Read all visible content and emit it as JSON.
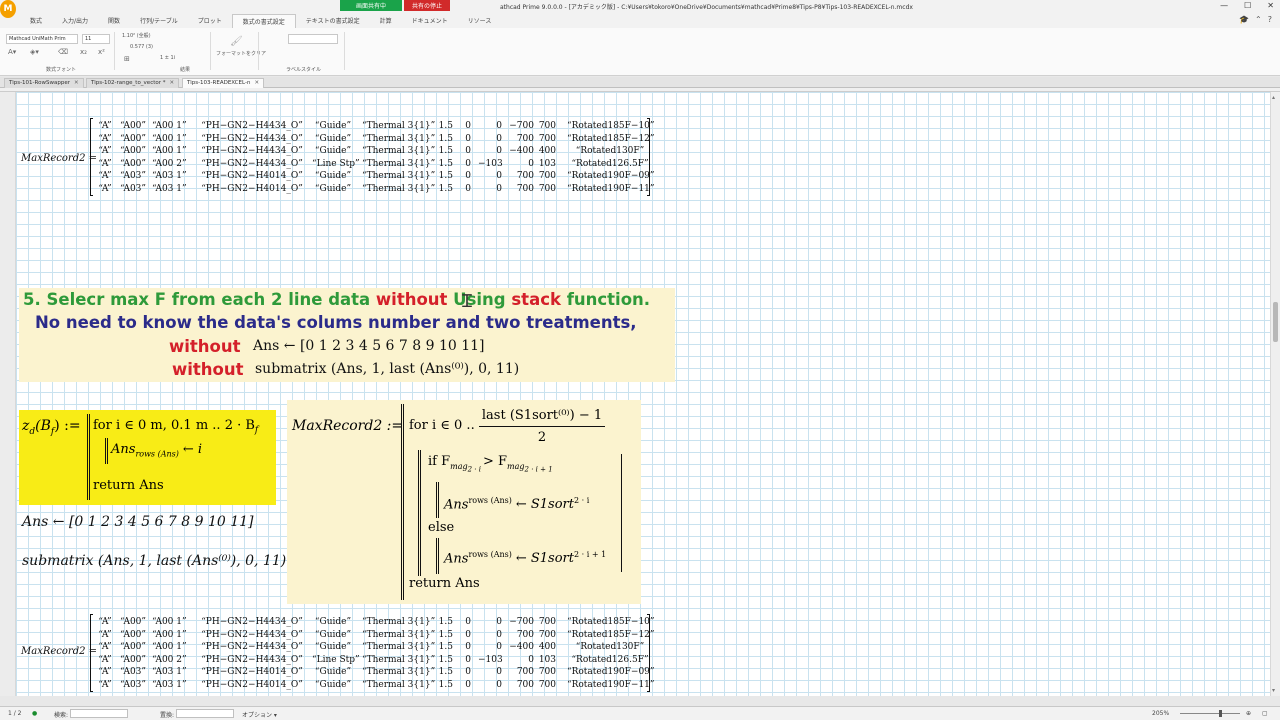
{
  "app": {
    "logo": "M",
    "title": "athcad Prime 9.0.0.0 - [アカデミック版] - C:¥Users¥tokoro¥OneDrive¥Documents¥mathcad¥Prime8¥Tips-P8¥Tips-103-READEXCEL-n.mcdx",
    "share_status": "画面共有中",
    "share_stop": "共有の停止",
    "window_controls": [
      "—",
      "☐",
      "✕"
    ]
  },
  "ribbon_tabs": [
    "数式",
    "入力/出力",
    "関数",
    "行列/テーブル",
    "プロット",
    "数式の書式設定",
    "テキストの書式設定",
    "計算",
    "ドキュメント",
    "リソース"
  ],
  "ribbon_active_tab": "数式の書式設定",
  "ribbon": {
    "font_name": "Mathcad UniMath Prim",
    "font_size": "11",
    "font_group_label": "数式フォント",
    "label_dropdown": "1.10² (全般)",
    "precision": "0.577 (3)",
    "zero_threshold": "1 ± 1i",
    "display_group_label": "結果",
    "format_painter": "フォーマットをクリア",
    "style_group_label": "ラベルスタイル"
  },
  "doc_tabs": [
    {
      "label": "Tips-101-RowSwapper",
      "active": false
    },
    {
      "label": "Tips-102-range_to_vector *",
      "active": false
    },
    {
      "label": "Tips-103-READEXCEL-n",
      "active": true
    }
  ],
  "matrix_label": "MaxRecord2 =",
  "matrix_rows": [
    [
      "“A”",
      "“A00”",
      "“A00 1”",
      "“PH−GN2−H4434_O”",
      "“Guide”",
      "“Thermal 3{1}”",
      "1.5",
      "0",
      "0",
      "−700",
      "700",
      "“Rotated185F−10”"
    ],
    [
      "“A”",
      "“A00”",
      "“A00 1”",
      "“PH−GN2−H4434_O”",
      "“Guide”",
      "“Thermal 3{1}”",
      "1.5",
      "0",
      "0",
      "700",
      "700",
      "“Rotated185F−12”"
    ],
    [
      "“A”",
      "“A00”",
      "“A00 1”",
      "“PH−GN2−H4434_O”",
      "“Guide”",
      "“Thermal 3{1}”",
      "1.5",
      "0",
      "0",
      "−400",
      "400",
      "“Rotated130F”"
    ],
    [
      "“A”",
      "“A00”",
      "“A00 2”",
      "“PH−GN2−H4434_O”",
      "“Line Stp”",
      "“Thermal 3{1}”",
      "1.5",
      "0",
      "−103",
      "0",
      "103",
      "“Rotated126.5F”"
    ],
    [
      "“A”",
      "“A03”",
      "“A03 1”",
      "“PH−GN2−H4014_O”",
      "“Guide”",
      "“Thermal 3{1}”",
      "1.5",
      "0",
      "0",
      "700",
      "700",
      "“Rotated190F−09”"
    ],
    [
      "“A”",
      "“A03”",
      "“A03 1”",
      "“PH−GN2−H4014_O”",
      "“Guide”",
      "“Thermal 3{1}”",
      "1.5",
      "0",
      "0",
      "700",
      "700",
      "“Rotated190F−11”"
    ]
  ],
  "heading": {
    "line1_a": "5. Selecr max F from each 2 line data ",
    "line1_b": "without ",
    "line1_c": "Using ",
    "line1_d": "stack",
    "line1_e": " function.",
    "line2": "No need to know the data's colums number and two treatments,",
    "without": "without",
    "ans_assign": "Ans ← [0  1  2  3  4  5  6  7  8  9  10  11]",
    "submatrix_expr": "submatrix (Ans, 1, last (Ans⁽⁰⁾), 0, 11)"
  },
  "zd": {
    "def": "z",
    "def_sub": "d",
    "def_arg": "(B",
    "def_arg_sub": "f",
    "assign": ") :=",
    "for_line": "for i ∈ 0 m, 0.1 m .. 2 · B",
    "for_sub": "f",
    "body_ans": "Ans",
    "body_sub": "rows (Ans)",
    "body_rhs": "← i",
    "ret": "return Ans"
  },
  "ans_line": "Ans ← [0  1  2  3  4  5  6  7  8  9  10  11]",
  "sub_line": "submatrix (Ans, 1, last (Ans⁽⁰⁾), 0, 11)",
  "mr2": {
    "name": "MaxRecord2 :=",
    "for": "for i ∈ 0 ..",
    "frac_num": "last (S1sort⁽⁰⁾) − 1",
    "frac_den": "2",
    "if": "if F",
    "if_sub1": "mag",
    "if_sub1b": "2 · i",
    "if_gt": "> F",
    "if_sub2": "mag",
    "if_sub2b": "2 · i + 1",
    "then_lhs": "Ans",
    "then_sup": "rows (Ans)",
    "then_rhs": "← S1sort",
    "then_rhs_sup": "2 · i",
    "else": "else",
    "else_rhs_sup": "2 · i + 1",
    "ret": "return Ans"
  },
  "status": {
    "page": "1 / 2",
    "search_label": "検索:",
    "replace_label": "置換:",
    "options": "オプション ▾",
    "zoom": "205%"
  }
}
